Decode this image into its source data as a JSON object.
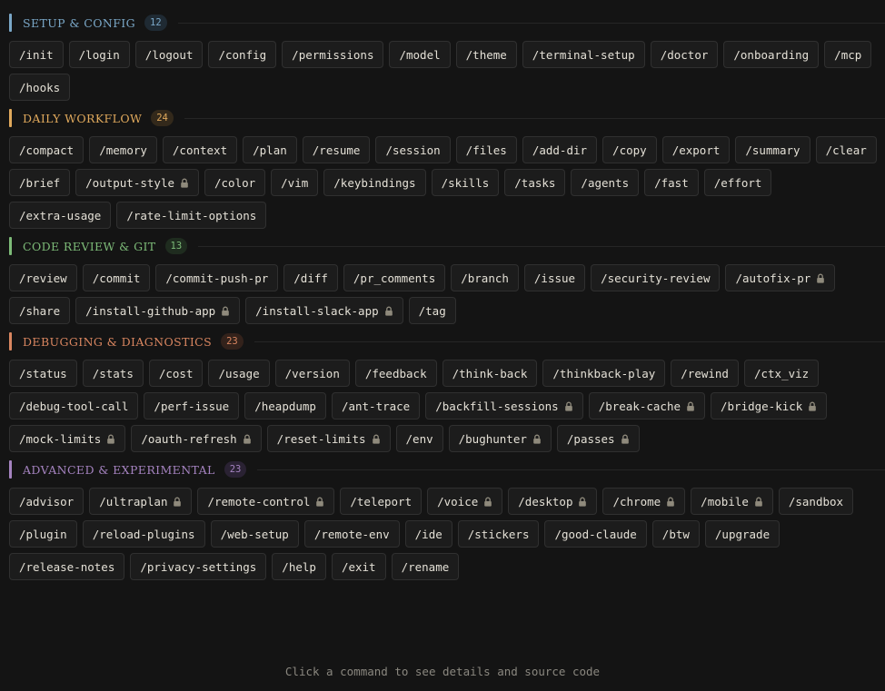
{
  "footer": {
    "hint": "Click a command to see details and source code"
  },
  "sections": [
    {
      "title": "SETUP & CONFIG",
      "count": "12",
      "color": "#7aa7c7",
      "count_bg": "#1f2a33",
      "commands": [
        {
          "label": "/init"
        },
        {
          "label": "/login"
        },
        {
          "label": "/logout"
        },
        {
          "label": "/config"
        },
        {
          "label": "/permissions"
        },
        {
          "label": "/model"
        },
        {
          "label": "/theme"
        },
        {
          "label": "/terminal-setup"
        },
        {
          "label": "/doctor"
        },
        {
          "label": "/onboarding"
        },
        {
          "label": "/mcp"
        },
        {
          "label": "/hooks"
        }
      ]
    },
    {
      "title": "DAILY WORKFLOW",
      "count": "24",
      "color": "#e0a95c",
      "count_bg": "#33291b",
      "commands": [
        {
          "label": "/compact"
        },
        {
          "label": "/memory"
        },
        {
          "label": "/context"
        },
        {
          "label": "/plan"
        },
        {
          "label": "/resume"
        },
        {
          "label": "/session"
        },
        {
          "label": "/files"
        },
        {
          "label": "/add-dir"
        },
        {
          "label": "/copy"
        },
        {
          "label": "/export"
        },
        {
          "label": "/summary"
        },
        {
          "label": "/clear"
        },
        {
          "label": "/brief"
        },
        {
          "label": "/output-style",
          "locked": true
        },
        {
          "label": "/color"
        },
        {
          "label": "/vim"
        },
        {
          "label": "/keybindings"
        },
        {
          "label": "/skills"
        },
        {
          "label": "/tasks"
        },
        {
          "label": "/agents"
        },
        {
          "label": "/fast"
        },
        {
          "label": "/effort"
        },
        {
          "label": "/extra-usage"
        },
        {
          "label": "/rate-limit-options"
        }
      ]
    },
    {
      "title": "CODE REVIEW & GIT",
      "count": "13",
      "color": "#7dbb78",
      "count_bg": "#1f2c1f",
      "commands": [
        {
          "label": "/review"
        },
        {
          "label": "/commit"
        },
        {
          "label": "/commit-push-pr"
        },
        {
          "label": "/diff"
        },
        {
          "label": "/pr_comments"
        },
        {
          "label": "/branch"
        },
        {
          "label": "/issue"
        },
        {
          "label": "/security-review"
        },
        {
          "label": "/autofix-pr",
          "locked": true
        },
        {
          "label": "/share"
        },
        {
          "label": "/install-github-app",
          "locked": true
        },
        {
          "label": "/install-slack-app",
          "locked": true
        },
        {
          "label": "/tag"
        }
      ]
    },
    {
      "title": "DEBUGGING & DIAGNOSTICS",
      "count": "23",
      "color": "#d98660",
      "count_bg": "#33221b",
      "commands": [
        {
          "label": "/status"
        },
        {
          "label": "/stats"
        },
        {
          "label": "/cost"
        },
        {
          "label": "/usage"
        },
        {
          "label": "/version"
        },
        {
          "label": "/feedback"
        },
        {
          "label": "/think-back"
        },
        {
          "label": "/thinkback-play"
        },
        {
          "label": "/rewind"
        },
        {
          "label": "/ctx_viz"
        },
        {
          "label": "/debug-tool-call"
        },
        {
          "label": "/perf-issue"
        },
        {
          "label": "/heapdump"
        },
        {
          "label": "/ant-trace"
        },
        {
          "label": "/backfill-sessions",
          "locked": true
        },
        {
          "label": "/break-cache",
          "locked": true
        },
        {
          "label": "/bridge-kick",
          "locked": true
        },
        {
          "label": "/mock-limits",
          "locked": true
        },
        {
          "label": "/oauth-refresh",
          "locked": true
        },
        {
          "label": "/reset-limits",
          "locked": true
        },
        {
          "label": "/env"
        },
        {
          "label": "/bughunter",
          "locked": true
        },
        {
          "label": "/passes",
          "locked": true
        }
      ]
    },
    {
      "title": "ADVANCED & EXPERIMENTAL",
      "count": "23",
      "color": "#a583c0",
      "count_bg": "#2a2233",
      "commands": [
        {
          "label": "/advisor"
        },
        {
          "label": "/ultraplan",
          "locked": true
        },
        {
          "label": "/remote-control",
          "locked": true
        },
        {
          "label": "/teleport"
        },
        {
          "label": "/voice",
          "locked": true
        },
        {
          "label": "/desktop",
          "locked": true
        },
        {
          "label": "/chrome",
          "locked": true
        },
        {
          "label": "/mobile",
          "locked": true
        },
        {
          "label": "/sandbox"
        },
        {
          "label": "/plugin"
        },
        {
          "label": "/reload-plugins"
        },
        {
          "label": "/web-setup"
        },
        {
          "label": "/remote-env"
        },
        {
          "label": "/ide"
        },
        {
          "label": "/stickers"
        },
        {
          "label": "/good-claude"
        },
        {
          "label": "/btw"
        },
        {
          "label": "/upgrade"
        },
        {
          "label": "/release-notes"
        },
        {
          "label": "/privacy-settings"
        },
        {
          "label": "/help"
        },
        {
          "label": "/exit"
        },
        {
          "label": "/rename"
        }
      ]
    }
  ]
}
